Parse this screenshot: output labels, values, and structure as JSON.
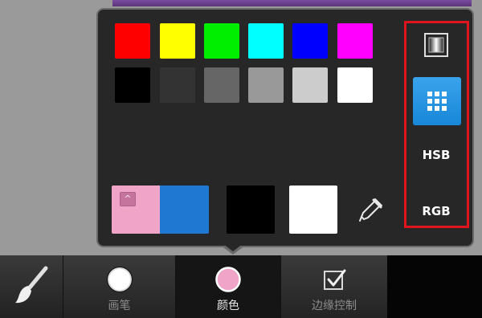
{
  "palette": {
    "row1": [
      "#ff0000",
      "#ffff00",
      "#00ee00",
      "#00ffff",
      "#0000ff",
      "#ff00ff"
    ],
    "row2": [
      "#000000",
      "#333333",
      "#666666",
      "#999999",
      "#cccccc",
      "#ffffff"
    ]
  },
  "current": {
    "fill_color": "#f0a5c8",
    "new_color": "#1f78d1",
    "stroke_black": "#000000",
    "stroke_white": "#ffffff",
    "up_glyph": "^"
  },
  "mode_panel": {
    "icons": [
      "gradient-icon",
      "grid-icon"
    ],
    "hsb_label": "HSB",
    "rgb_label": "RGB"
  },
  "toolbar": {
    "brush_icon": "brush-icon",
    "tabs": [
      {
        "label": "画笔",
        "icon": "circle-icon"
      },
      {
        "label": "颜色",
        "icon": "color-circle-icon",
        "active": true
      },
      {
        "label": "边缘控制",
        "icon": "checkbox-icon"
      }
    ]
  },
  "accent_color": "#1787d8",
  "highlight_color": "#e0141d"
}
